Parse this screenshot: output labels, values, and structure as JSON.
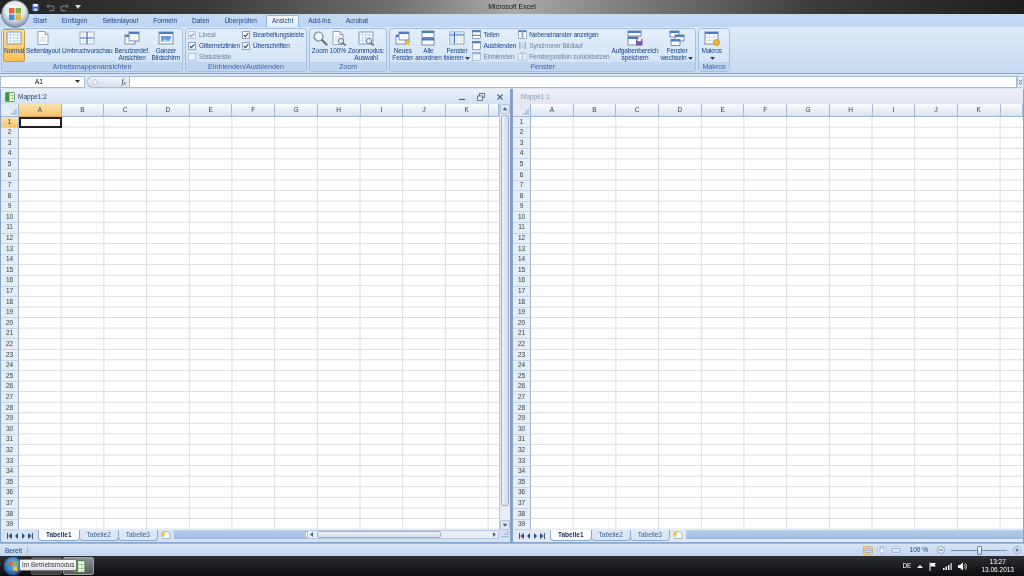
{
  "title_bar": {
    "title": "Microsoft Excel"
  },
  "ribbon": {
    "tabs": [
      {
        "label": "Start",
        "selected": false
      },
      {
        "label": "Einfügen",
        "selected": false
      },
      {
        "label": "Seitenlayout",
        "selected": false
      },
      {
        "label": "Formeln",
        "selected": false
      },
      {
        "label": "Daten",
        "selected": false
      },
      {
        "label": "Überprüfen",
        "selected": false
      },
      {
        "label": "Ansicht",
        "selected": true
      },
      {
        "label": "Add-Ins",
        "selected": false
      },
      {
        "label": "Acrobat",
        "selected": false
      }
    ],
    "groups": [
      {
        "label": "Arbeitsmappenansichten",
        "columns": [
          {
            "kind": "large",
            "lines": [
              "Normal"
            ],
            "selected": true,
            "menu": false
          },
          {
            "kind": "large",
            "lines": [
              "Seitenlayout"
            ],
            "selected": false,
            "menu": false
          },
          {
            "kind": "large",
            "lines": [
              "Umbruchvorschau"
            ],
            "selected": false,
            "menu": false
          },
          {
            "kind": "large",
            "lines": [
              "Benutzerdef.",
              "Ansichten"
            ],
            "selected": false,
            "menu": false
          },
          {
            "kind": "large",
            "lines": [
              "Ganzer",
              "Bildschirm"
            ],
            "selected": false,
            "menu": false
          }
        ]
      },
      {
        "label": "Einblenden/Ausblenden",
        "columns": [
          {
            "kind": "stack",
            "items": [
              {
                "kind": "check",
                "label": "Lineal",
                "checked": true,
                "disabled": true
              },
              {
                "kind": "check",
                "label": "Gitternetzlinien",
                "checked": true,
                "disabled": false
              },
              {
                "kind": "check",
                "label": "Statusleiste",
                "checked": false,
                "disabled": true
              }
            ]
          },
          {
            "kind": "stack",
            "items": [
              {
                "kind": "check",
                "label": "Bearbeitungsleiste",
                "checked": true,
                "disabled": false
              },
              {
                "kind": "check",
                "label": "Überschriften",
                "checked": true,
                "disabled": false
              }
            ]
          }
        ]
      },
      {
        "label": "Zoom",
        "columns": [
          {
            "kind": "large",
            "lines": [
              "Zoom"
            ],
            "menu": false
          },
          {
            "kind": "large",
            "lines": [
              "100%"
            ],
            "menu": false
          },
          {
            "kind": "large",
            "lines": [
              "Zoommodus:",
              "Auswahl"
            ],
            "menu": false
          }
        ]
      },
      {
        "label": "Fenster",
        "columns": [
          {
            "kind": "large",
            "lines": [
              "Neues",
              "Fenster"
            ],
            "menu": false
          },
          {
            "kind": "large",
            "lines": [
              "Alle",
              "anordnen"
            ],
            "menu": false
          },
          {
            "kind": "large",
            "lines": [
              "Fenster",
              "fixieren"
            ],
            "menu": true
          },
          {
            "kind": "stack",
            "items": [
              {
                "kind": "small",
                "label": "Teilen",
                "disabled": false
              },
              {
                "kind": "small",
                "label": "Ausblenden",
                "disabled": false
              },
              {
                "kind": "small",
                "label": "Einblenden",
                "disabled": true
              }
            ]
          },
          {
            "kind": "stack",
            "items": [
              {
                "kind": "small",
                "label": "Nebeneinander anzeigen",
                "disabled": false
              },
              {
                "kind": "small",
                "label": "Synchroner Bildlauf",
                "disabled": true
              },
              {
                "kind": "small",
                "label": "Fensterposition zurücksetzen",
                "disabled": true
              }
            ]
          },
          {
            "kind": "large",
            "lines": [
              "Aufgabenbereich",
              "speichern"
            ],
            "menu": false
          },
          {
            "kind": "large",
            "lines": [
              "Fenster",
              "wechseln"
            ],
            "menu": true
          }
        ]
      },
      {
        "label": "Makros",
        "columns": [
          {
            "kind": "large",
            "lines": [
              "Makros"
            ],
            "menu": true
          }
        ]
      }
    ]
  },
  "formula_bar": {
    "name_box": "A1",
    "function_button": "f$_{x}$"
  },
  "windows": [
    {
      "title": "Mappe1:2",
      "active": true,
      "columns": [
        {
          "label": "A",
          "selected": true
        },
        {
          "label": "B",
          "selected": false
        },
        {
          "label": "C",
          "selected": false
        },
        {
          "label": "D",
          "selected": false
        },
        {
          "label": "E",
          "selected": false
        },
        {
          "label": "F",
          "selected": false
        },
        {
          "label": "G",
          "selected": false
        },
        {
          "label": "H",
          "selected": false
        },
        {
          "label": "I",
          "selected": false
        },
        {
          "label": "J",
          "selected": false
        },
        {
          "label": "K",
          "selected": false
        }
      ],
      "rows": [
        {
          "label": "1",
          "selected": true
        },
        {
          "label": "2",
          "selected": false
        },
        {
          "label": "3",
          "selected": false
        },
        {
          "label": "4",
          "selected": false
        },
        {
          "label": "5",
          "selected": false
        },
        {
          "label": "6",
          "selected": false
        },
        {
          "label": "7",
          "selected": false
        },
        {
          "label": "8",
          "selected": false
        },
        {
          "label": "9",
          "selected": false
        },
        {
          "label": "10",
          "selected": false
        },
        {
          "label": "11",
          "selected": false
        },
        {
          "label": "12",
          "selected": false
        },
        {
          "label": "13",
          "selected": false
        },
        {
          "label": "14",
          "selected": false
        },
        {
          "label": "15",
          "selected": false
        },
        {
          "label": "16",
          "selected": false
        },
        {
          "label": "17",
          "selected": false
        },
        {
          "label": "18",
          "selected": false
        },
        {
          "label": "19",
          "selected": false
        },
        {
          "label": "20",
          "selected": false
        },
        {
          "label": "21",
          "selected": false
        },
        {
          "label": "22",
          "selected": false
        },
        {
          "label": "23",
          "selected": false
        },
        {
          "label": "24",
          "selected": false
        },
        {
          "label": "25",
          "selected": false
        },
        {
          "label": "26",
          "selected": false
        },
        {
          "label": "27",
          "selected": false
        },
        {
          "label": "28",
          "selected": false
        },
        {
          "label": "29",
          "selected": false
        },
        {
          "label": "30",
          "selected": false
        },
        {
          "label": "31",
          "selected": false
        },
        {
          "label": "32",
          "selected": false
        },
        {
          "label": "33",
          "selected": false
        },
        {
          "label": "34",
          "selected": false
        },
        {
          "label": "35",
          "selected": false
        },
        {
          "label": "36",
          "selected": false
        },
        {
          "label": "37",
          "selected": false
        },
        {
          "label": "38",
          "selected": false
        },
        {
          "label": "39",
          "selected": false
        }
      ],
      "sheet_tabs": [
        {
          "label": "Tabelle1",
          "selected": true
        },
        {
          "label": "Tabelle2",
          "selected": false
        },
        {
          "label": "Tabelle3",
          "selected": false
        }
      ]
    },
    {
      "title": "Mappe1:1",
      "active": false,
      "columns": [
        {
          "label": "A",
          "selected": false
        },
        {
          "label": "B",
          "selected": false
        },
        {
          "label": "C",
          "selected": false
        },
        {
          "label": "D",
          "selected": false
        },
        {
          "label": "E",
          "selected": false
        },
        {
          "label": "F",
          "selected": false
        },
        {
          "label": "G",
          "selected": false
        },
        {
          "label": "H",
          "selected": false
        },
        {
          "label": "I",
          "selected": false
        },
        {
          "label": "J",
          "selected": false
        },
        {
          "label": "K",
          "selected": false
        }
      ],
      "rows": [
        {
          "label": "1",
          "selected": false
        },
        {
          "label": "2",
          "selected": false
        },
        {
          "label": "3",
          "selected": false
        },
        {
          "label": "4",
          "selected": false
        },
        {
          "label": "5",
          "selected": false
        },
        {
          "label": "6",
          "selected": false
        },
        {
          "label": "7",
          "selected": false
        },
        {
          "label": "8",
          "selected": false
        },
        {
          "label": "9",
          "selected": false
        },
        {
          "label": "10",
          "selected": false
        },
        {
          "label": "11",
          "selected": false
        },
        {
          "label": "12",
          "selected": false
        },
        {
          "label": "13",
          "selected": false
        },
        {
          "label": "14",
          "selected": false
        },
        {
          "label": "15",
          "selected": false
        },
        {
          "label": "16",
          "selected": false
        },
        {
          "label": "17",
          "selected": false
        },
        {
          "label": "18",
          "selected": false
        },
        {
          "label": "19",
          "selected": false
        },
        {
          "label": "20",
          "selected": false
        },
        {
          "label": "21",
          "selected": false
        },
        {
          "label": "22",
          "selected": false
        },
        {
          "label": "23",
          "selected": false
        },
        {
          "label": "24",
          "selected": false
        },
        {
          "label": "25",
          "selected": false
        },
        {
          "label": "26",
          "selected": false
        },
        {
          "label": "27",
          "selected": false
        },
        {
          "label": "28",
          "selected": false
        },
        {
          "label": "29",
          "selected": false
        },
        {
          "label": "30",
          "selected": false
        },
        {
          "label": "31",
          "selected": false
        },
        {
          "label": "32",
          "selected": false
        },
        {
          "label": "33",
          "selected": false
        },
        {
          "label": "34",
          "selected": false
        },
        {
          "label": "35",
          "selected": false
        },
        {
          "label": "36",
          "selected": false
        },
        {
          "label": "37",
          "selected": false
        },
        {
          "label": "38",
          "selected": false
        },
        {
          "label": "39",
          "selected": false
        }
      ],
      "sheet_tabs": [
        {
          "label": "Tabelle1",
          "selected": true
        },
        {
          "label": "Tabelle2",
          "selected": false
        },
        {
          "label": "Tabelle3",
          "selected": false
        }
      ]
    }
  ],
  "status_bar": {
    "status": "Bereit",
    "view_buttons": [
      {
        "selected": true
      },
      {
        "selected": false
      },
      {
        "selected": false
      }
    ],
    "zoom": "100 %",
    "zoom_slider": {
      "level": 0.5
    }
  },
  "taskbar": {
    "apps": [
      {
        "selected": false
      },
      {
        "selected": true
      }
    ],
    "tooltip": "Im Betriebsmodus",
    "language": "DE",
    "time": "13:27",
    "date": "13.06.2013"
  }
}
